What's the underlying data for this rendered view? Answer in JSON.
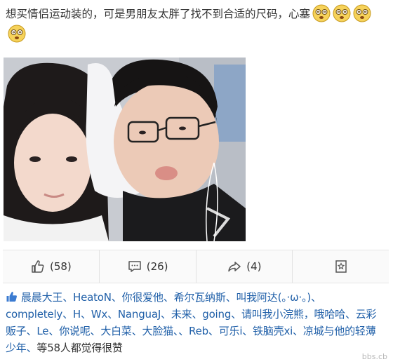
{
  "post": {
    "text": "想买情侣运动装的，可是男朋友太胖了找不到合适的尺码，心塞"
  },
  "emoji_icon": "dizzy-face-emoji",
  "actions": {
    "like_label": "(58)",
    "comment_label": "(26)",
    "forward_label": "(4)"
  },
  "likers": {
    "names": "晨晨大王、HeatoN、你很爱他、希尔瓦纳斯、叫我阿达(。·ω·。)、completely、H、Wx、NanguaJ、未来、going、请叫我小浣熊，哦哈哈、云彩贩子、Le、你说呢、大白菜、大脸猫、、Reb、可乐i、铁脑壳xi、凉城与他的轻薄少年、",
    "tail": "等58人都觉得很赞"
  },
  "watermark": "bbs.cb",
  "colors": {
    "link": "#1f5fa8",
    "text": "#333333",
    "bar_bg": "#fafafa"
  }
}
